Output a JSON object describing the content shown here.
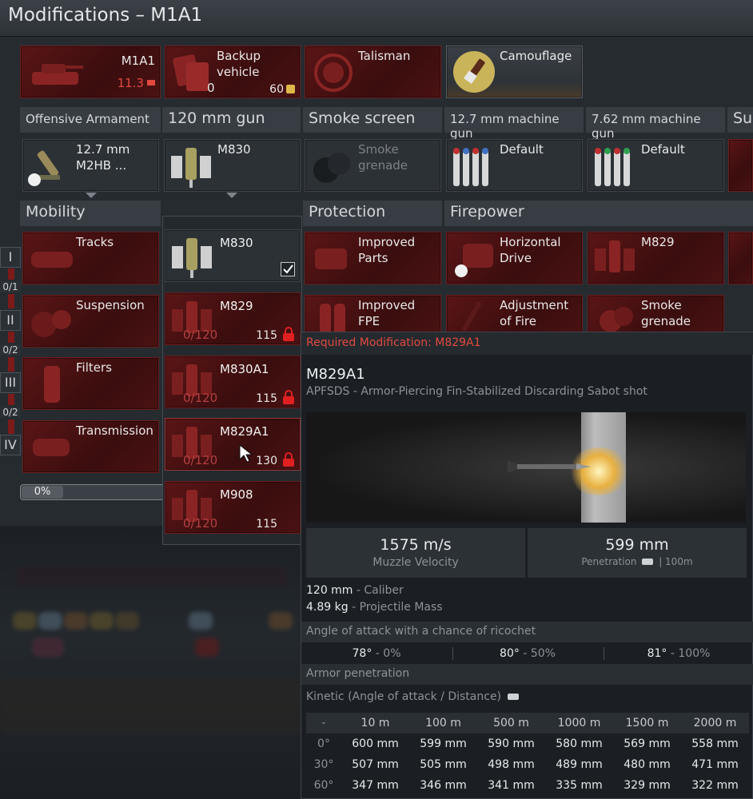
{
  "window": {
    "title": "Modifications – M1A1"
  },
  "top_slots": [
    {
      "name": "M1A1",
      "value": "11.3",
      "icon": "tank-icon"
    },
    {
      "name": "Backup vehicle",
      "count": "0",
      "price": "60",
      "icon": "backup-vehicle-icon"
    },
    {
      "name": "Talisman",
      "icon": "talisman-icon"
    },
    {
      "name": "Camouflage",
      "icon": "paint-brush-icon"
    }
  ],
  "weapons": {
    "headers": [
      "Offensive Armament",
      "120 mm gun",
      "Smoke screen",
      "12.7 mm machine gun",
      "7.62 mm machine gun",
      "Sup"
    ],
    "slots": [
      {
        "label": "12.7 mm M2HB ..."
      },
      {
        "label": "M830"
      },
      {
        "label": "Smoke grenade"
      },
      {
        "label": "Default"
      },
      {
        "label": "Default"
      }
    ]
  },
  "categories": {
    "mobility": "Mobility",
    "protection": "Protection",
    "firepower": "Firepower"
  },
  "tiers": {
    "labels": [
      "I",
      "II",
      "III",
      "IV"
    ],
    "counts": [
      "0/1",
      "0/2",
      "0/2"
    ]
  },
  "mobility": [
    {
      "label": "Tracks"
    },
    {
      "label": "Suspension"
    },
    {
      "label": "Filters"
    },
    {
      "label": "Transmission"
    }
  ],
  "protection": [
    {
      "label": "Improved Parts"
    },
    {
      "label": "Improved FPE"
    }
  ],
  "firepower": [
    {
      "label": "Horizontal Drive"
    },
    {
      "label": "M829"
    },
    {
      "label": "Adjustment of Fire"
    },
    {
      "label": "Smoke grenade"
    }
  ],
  "progress": {
    "label": "0%",
    "value": 0
  },
  "shells": [
    {
      "name": "M830",
      "selected": true
    },
    {
      "name": "M829",
      "count": "0/120",
      "price": "115"
    },
    {
      "name": "M830A1",
      "count": "0/120",
      "price": "115"
    },
    {
      "name": "M829A1",
      "count": "0/120",
      "price": "130"
    },
    {
      "name": "M908",
      "count": "0/120",
      "price": "115"
    }
  ],
  "tooltip": {
    "required": "Required Modification: M829A1",
    "name": "M829A1",
    "description": "APFSDS - Armor-Piercing Fin-Stabilized Discarding Sabot shot",
    "velocity_value": "1575 m/s",
    "velocity_label": "Muzzle Velocity",
    "penetration_value": "599 mm",
    "penetration_label": "Penetration",
    "penetration_distance": "| 100m",
    "caliber_value": "120 mm",
    "caliber_label": "- Caliber",
    "mass_value": "4.89 kg",
    "mass_label": "- Projectile Mass",
    "ricochet_title": "Angle of attack with a chance of ricochet",
    "ricochet": [
      {
        "angle": "78°",
        "chance": "- 0%"
      },
      {
        "angle": "80°",
        "chance": "- 50%"
      },
      {
        "angle": "81°",
        "chance": "- 100%"
      }
    ],
    "armor_title": "Armor penetration",
    "kinetic_title": "Kinetic (Angle of attack / Distance)",
    "table": {
      "corner": "-",
      "columns": [
        "10 m",
        "100 m",
        "500 m",
        "1000 m",
        "1500 m",
        "2000 m"
      ],
      "rows": [
        {
          "angle": "0°",
          "values": [
            "600 mm",
            "599 mm",
            "590 mm",
            "580 mm",
            "569 mm",
            "558 mm"
          ]
        },
        {
          "angle": "30°",
          "values": [
            "507 mm",
            "505 mm",
            "498 mm",
            "489 mm",
            "480 mm",
            "471 mm"
          ]
        },
        {
          "angle": "60°",
          "values": [
            "347 mm",
            "346 mm",
            "341 mm",
            "335 mm",
            "329 mm",
            "322 mm"
          ]
        }
      ]
    }
  },
  "colors": {
    "tile_red": "#5a1516",
    "warning_red": "#e0493f",
    "panel": "#262b30"
  }
}
